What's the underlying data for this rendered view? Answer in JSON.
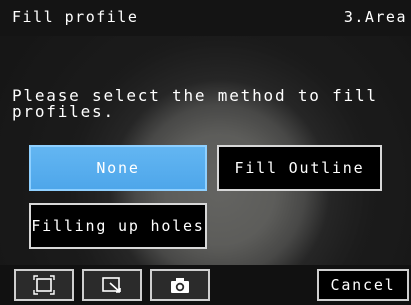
{
  "header": {
    "title": "Fill profile",
    "area": "3.Area"
  },
  "message": "Please select the method to fill\nprofiles.",
  "options": {
    "none": "None",
    "fill_outline": "Fill Outline",
    "filling_up_holes": "Filling up holes"
  },
  "toolbar": {
    "icons": [
      "frame-fit-icon",
      "zoom-region-icon",
      "camera-icon"
    ],
    "cancel_label": "Cancel"
  },
  "colors": {
    "selected": "#4ea6ea",
    "titlebar": "#141414"
  }
}
